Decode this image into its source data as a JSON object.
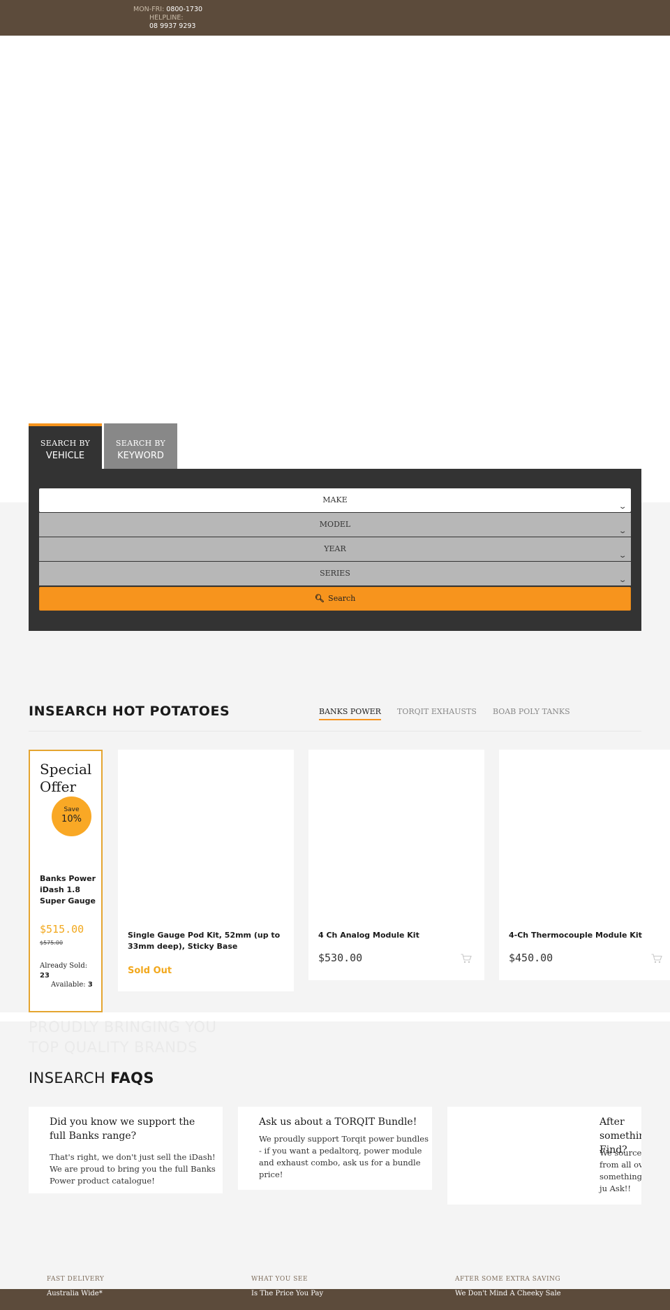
{
  "topbar": {
    "hours_label": "MON-FRI:",
    "hours_value": "0800-1730",
    "helpline_label": "HELPLINE:",
    "helpline_phone": "08 9937 9293"
  },
  "search": {
    "tabs": [
      {
        "small": "SEARCH BY",
        "big": "VEHICLE"
      },
      {
        "small": "SEARCH BY",
        "big": "KEYWORD"
      }
    ],
    "make_label": "MAKE",
    "model_label": "MODEL",
    "year_label": "YEAR",
    "series_label": "SERIES",
    "button_label": "Search"
  },
  "hot": {
    "title": "INSEARCH HOT POTATOES",
    "categories": [
      "BANKS POWER",
      "TORQIT EXHAUSTS",
      "BOAB POLY TANKS"
    ],
    "special": {
      "heading_line1": "Special",
      "heading_line2": "Offer",
      "save_label": "Save",
      "save_percent": "10%",
      "name": "Banks Power iDash 1.8 Super Gauge",
      "price": "$515.00",
      "old_price": "$575.00",
      "sold_label": "Already Sold:",
      "sold_value": "23",
      "available_label": "Available:",
      "available_value": "3"
    },
    "products": [
      {
        "title": "Single Gauge Pod Kit, 52mm (up to 33mm deep), Sticky Base",
        "status": "Sold Out"
      },
      {
        "title": "4 Ch Analog Module Kit",
        "price": "$530.00"
      },
      {
        "title": "4-Ch Thermocouple Module Kit",
        "price": "$450.00"
      }
    ]
  },
  "brands": {
    "line1": "PROUDLY BRINGING YOU",
    "line2": "TOP QUALITY BRANDS"
  },
  "faqs": {
    "title_light": "INSEARCH ",
    "title_bold": "FAQS",
    "items": [
      {
        "q": "Did you know we support the full Banks range?",
        "a": "That's right, we don't just sell the iDash! We are proud to bring you the full Banks Power product catalogue!"
      },
      {
        "q": "Ask us about a TORQIT Bundle!",
        "a": "We proudly support Torqit power bundles - if you want a pedaltorq, power module and exhaust combo, ask us for a bundle price!"
      },
      {
        "q": "After something Find?",
        "a": "We source Parts from all over the something you ju Ask!!"
      }
    ]
  },
  "footer": {
    "items": [
      {
        "title": "FAST DELIVERY",
        "sub": "Australia Wide*"
      },
      {
        "title": "WHAT YOU SEE",
        "sub": "Is The Price You Pay"
      },
      {
        "title": "AFTER SOME EXTRA SAVING",
        "sub": "We Don't Mind A Cheeky Sale"
      }
    ]
  },
  "colors": {
    "topbar": "#5c4b3b",
    "accent": "#f7941d",
    "panel": "#333333"
  }
}
